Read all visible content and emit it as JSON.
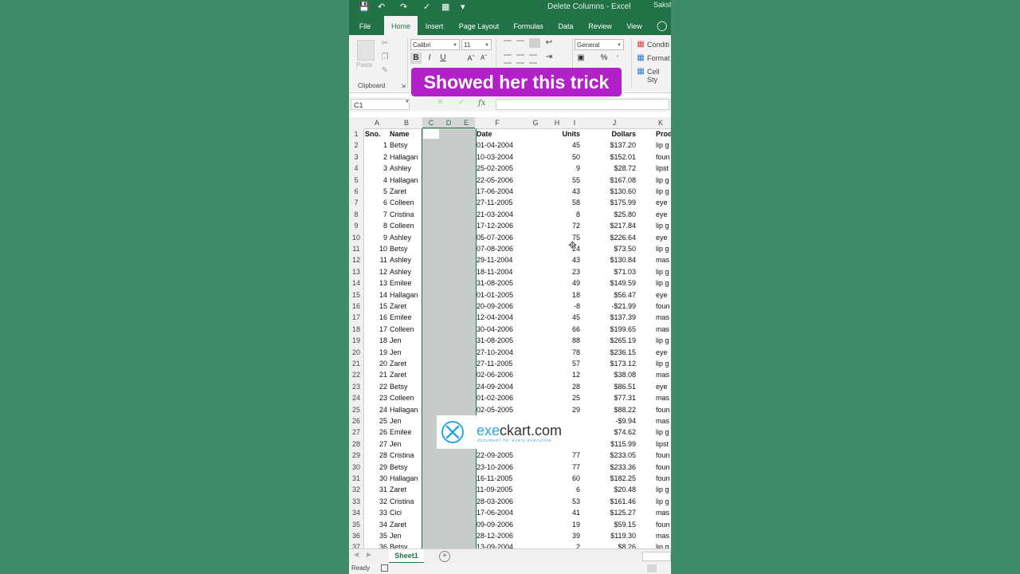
{
  "titlebar": {
    "title": "Delete Columns  -  Excel",
    "user": "Saksh",
    "save_icon": "save-icon",
    "undo_icon": "undo-icon",
    "redo_icon": "redo-icon"
  },
  "tabs": [
    "File",
    "Home",
    "Insert",
    "Page Layout",
    "Formulas",
    "Data",
    "Review",
    "View"
  ],
  "ribbon": {
    "clipboard_label": "Clipboard",
    "paste_label": "Paste",
    "font_name": "Calibri",
    "font_size": "11",
    "bold": "B",
    "italic": "I",
    "underline": "U",
    "number_format": "General",
    "percent": "%",
    "cond_format": "Conditi",
    "format_table": "Format",
    "cell_styles": "Cell Sty"
  },
  "banner": "Showed her this trick",
  "formula": {
    "namebox": "C1",
    "fx": "fx"
  },
  "columns": [
    "A",
    "B",
    "C",
    "D",
    "E",
    "F",
    "G",
    "H",
    "I",
    "J",
    "K"
  ],
  "headers": {
    "sno": "Sno.",
    "name": "Name",
    "date": "Date",
    "units": "Units",
    "dollars": "Dollars",
    "product": "Prod"
  },
  "rows": [
    [
      "1",
      "Betsy",
      "01-04-2004",
      "45",
      "$137.20",
      "lip g"
    ],
    [
      "2",
      "Hallagan",
      "10-03-2004",
      "50",
      "$152.01",
      "foun"
    ],
    [
      "3",
      "Ashley",
      "25-02-2005",
      "9",
      "$28.72",
      "lipst"
    ],
    [
      "4",
      "Hallagan",
      "22-05-2006",
      "55",
      "$167.08",
      "lip g"
    ],
    [
      "5",
      "Zaret",
      "17-06-2004",
      "43",
      "$130.60",
      "lip g"
    ],
    [
      "6",
      "Colleen",
      "27-11-2005",
      "58",
      "$175.99",
      "eye"
    ],
    [
      "7",
      "Cristina",
      "21-03-2004",
      "8",
      "$25.80",
      "eye"
    ],
    [
      "8",
      "Colleen",
      "17-12-2006",
      "72",
      "$217.84",
      "lip g"
    ],
    [
      "9",
      "Ashley",
      "05-07-2006",
      "75",
      "$226.64",
      "eye"
    ],
    [
      "10",
      "Betsy",
      "07-08-2006",
      "24",
      "$73.50",
      "lip g"
    ],
    [
      "11",
      "Ashley",
      "29-11-2004",
      "43",
      "$130.84",
      "mas"
    ],
    [
      "12",
      "Ashley",
      "18-11-2004",
      "23",
      "$71.03",
      "lip g"
    ],
    [
      "13",
      "Emilee",
      "31-08-2005",
      "49",
      "$149.59",
      "lip g"
    ],
    [
      "14",
      "Hallagan",
      "01-01-2005",
      "18",
      "$56.47",
      "eye"
    ],
    [
      "15",
      "Zaret",
      "20-09-2006",
      "-8",
      "-$21.99",
      "foun"
    ],
    [
      "16",
      "Emilee",
      "12-04-2004",
      "45",
      "$137.39",
      "mas"
    ],
    [
      "17",
      "Colleen",
      "30-04-2006",
      "66",
      "$199.65",
      "mas"
    ],
    [
      "18",
      "Jen",
      "31-08-2005",
      "88",
      "$265.19",
      "lip g"
    ],
    [
      "19",
      "Jen",
      "27-10-2004",
      "78",
      "$236.15",
      "eye"
    ],
    [
      "20",
      "Zaret",
      "27-11-2005",
      "57",
      "$173.12",
      "lip g"
    ],
    [
      "21",
      "Zaret",
      "02-06-2006",
      "12",
      "$38.08",
      "mas"
    ],
    [
      "22",
      "Betsy",
      "24-09-2004",
      "28",
      "$86.51",
      "eye"
    ],
    [
      "23",
      "Colleen",
      "01-02-2006",
      "25",
      "$77.31",
      "mas"
    ],
    [
      "24",
      "Hallagan",
      "02-05-2005",
      "29",
      "$88.22",
      "foun"
    ],
    [
      "25",
      "Jen",
      "",
      "",
      "-$9.94",
      "mas"
    ],
    [
      "26",
      "Emilee",
      "",
      "",
      "$74.62",
      "lip g"
    ],
    [
      "27",
      "Jen",
      "",
      "",
      "$115.99",
      "lipst"
    ],
    [
      "28",
      "Cristina",
      "22-09-2005",
      "77",
      "$233.05",
      "foun"
    ],
    [
      "29",
      "Betsy",
      "23-10-2006",
      "77",
      "$233.36",
      "foun"
    ],
    [
      "30",
      "Hallagan",
      "16-11-2005",
      "60",
      "$182.25",
      "foun"
    ],
    [
      "31",
      "Zaret",
      "11-09-2005",
      "6",
      "$20.48",
      "lip g"
    ],
    [
      "32",
      "Cristina",
      "28-03-2006",
      "53",
      "$161.46",
      "lip g"
    ],
    [
      "33",
      "Cici",
      "17-06-2004",
      "41",
      "$125.27",
      "mas"
    ],
    [
      "34",
      "Zaret",
      "09-09-2006",
      "19",
      "$59.15",
      "foun"
    ],
    [
      "35",
      "Jen",
      "28-12-2006",
      "39",
      "$119.30",
      "mas"
    ],
    [
      "36",
      "Betsy",
      "13-09-2004",
      "2",
      "$8.26",
      "lip g"
    ]
  ],
  "watermark": {
    "brand_pre": "exe",
    "brand_post": "ckart.com",
    "tagline": "document for every executive"
  },
  "sheet": {
    "tab": "Sheet1",
    "add": "+"
  },
  "status": {
    "ready": "Ready"
  },
  "colors": {
    "excel_green": "#217346",
    "banner": "#b220c8",
    "background": "#3f8a6a"
  }
}
